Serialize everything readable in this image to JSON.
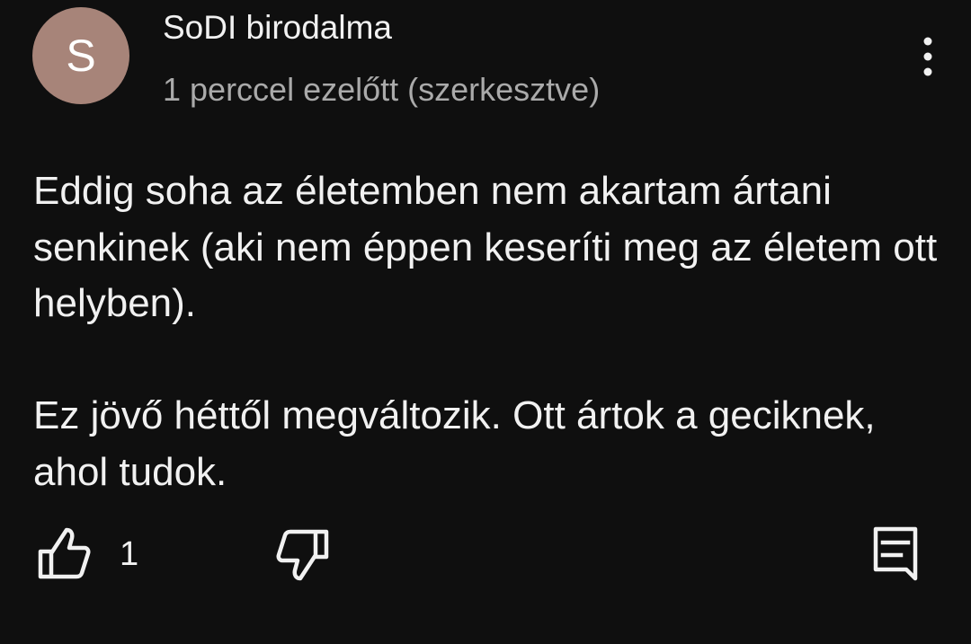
{
  "comment": {
    "avatar_letter": "S",
    "author": "SoDI birodalma",
    "timestamp": "1 perccel ezelőtt (szerkesztve)",
    "paragraphs": [
      "Eddig soha az életemben nem akartam ártani senkinek (aki nem éppen keseríti meg az életem ott helyben).",
      "Ez jövő héttől megváltozik. Ott ártok a geciknek, ahol tudok."
    ],
    "like_count": "1"
  },
  "icons": {
    "menu": "more-vertical-icon",
    "like": "thumbs-up-icon",
    "dislike": "thumbs-down-icon",
    "reply": "reply-comment-icon"
  },
  "colors": {
    "background": "#0f0f0f",
    "text_primary": "#f1f1f1",
    "text_secondary": "#aaaaaa",
    "avatar_bg": "#a78479"
  }
}
